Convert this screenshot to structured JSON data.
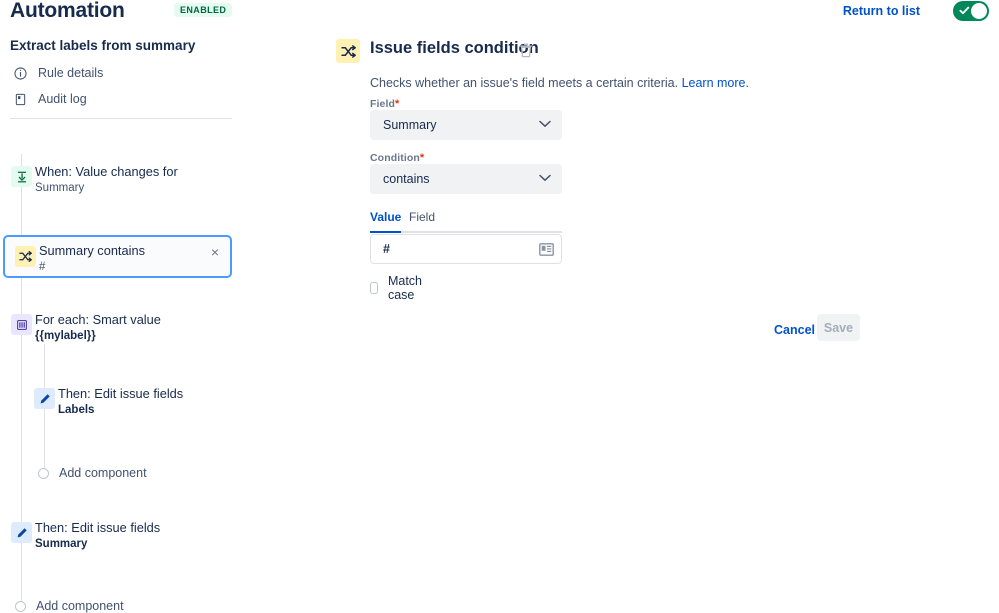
{
  "header": {
    "app_title": "Automation",
    "status_badge": "ENABLED",
    "return_link": "Return to list",
    "toggle_state_on": true,
    "toggle_color": "#00875A"
  },
  "sidebar": {
    "rule_name": "Extract labels from summary",
    "nav_items": [
      {
        "label": "Rule details",
        "icon": "info-circle-icon"
      },
      {
        "label": "Audit log",
        "icon": "audit-log-icon"
      }
    ],
    "tree": [
      {
        "title": "When: Value changes for",
        "subtitle": "Summary",
        "subtitle_bold": false,
        "icon": "trigger-icon",
        "icon_bg": "#E3FCEF",
        "icon_color": "#006644",
        "selected": false
      },
      {
        "title": "Summary contains",
        "subtitle": "#",
        "subtitle_bold": false,
        "icon": "condition-icon",
        "icon_bg": "#FFF0B3",
        "icon_color": "#172B4D",
        "selected": true,
        "close_label": "×"
      },
      {
        "title": "For each: Smart value",
        "subtitle": "{{mylabel}}",
        "subtitle_bold": true,
        "icon": "for-each-icon",
        "icon_bg": "#EAE6FF",
        "icon_color": "#5243AA",
        "selected": false
      },
      {
        "title": "Then: Edit issue fields",
        "subtitle": "Labels",
        "subtitle_bold": true,
        "icon": "pencil-icon",
        "icon_bg": "#DEEBFF",
        "icon_color": "#0747A6",
        "selected": false,
        "nested": true
      },
      {
        "title": "Then: Edit issue fields",
        "subtitle": "Summary",
        "subtitle_bold": true,
        "icon": "pencil-icon",
        "icon_bg": "#DEEBFF",
        "icon_color": "#0747A6",
        "selected": false
      }
    ],
    "add_component_nested": "Add component",
    "add_component_root": "Add component"
  },
  "main": {
    "title": "Issue fields condition",
    "icon": "condition-icon",
    "delete_icon": "trash-icon",
    "description_text": "Checks whether an issue's field meets a certain criteria. ",
    "description_link": "Learn more.",
    "field_label": "Field",
    "field_required_marker": "*",
    "field_value": "Summary",
    "condition_label": "Condition",
    "condition_required_marker": "*",
    "condition_value": "contains",
    "tabs": [
      {
        "label": "Value",
        "active": true
      },
      {
        "label": "Field",
        "active": false
      }
    ],
    "value_input": "#",
    "value_input_placeholder": "",
    "smart_value_icon": "smart-value-picker-icon",
    "match_case_label": "Match case",
    "match_case_checked": false,
    "cancel_label": "Cancel",
    "save_label": "Save",
    "save_disabled": true,
    "accent_color": "#0052CC"
  }
}
